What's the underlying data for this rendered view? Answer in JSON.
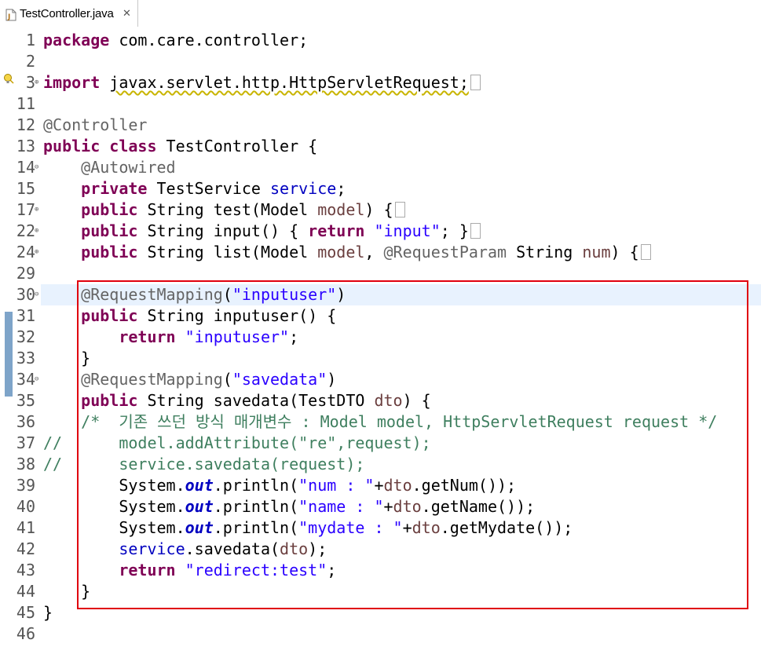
{
  "tab": {
    "title": "TestController.java",
    "close": "✕"
  },
  "lines": [
    {
      "num": "1",
      "fold": "",
      "html": "<span class='kw'>package</span> com.care.controller;"
    },
    {
      "num": "2",
      "fold": "",
      "html": ""
    },
    {
      "num": "3",
      "fold": "⊕",
      "html": "<span class='kw'>import</span> <span class='squig'>javax.servlet.http.HttpServletRequest;</span><span class='collapsed'></span>"
    },
    {
      "num": "11",
      "fold": "",
      "html": ""
    },
    {
      "num": "12",
      "fold": "",
      "html": "<span class='ann'>@Controller</span>"
    },
    {
      "num": "13",
      "fold": "",
      "html": "<span class='kw'>public</span> <span class='kw'>class</span> TestController {"
    },
    {
      "num": "14",
      "fold": "⊖",
      "html": "    <span class='ann'>@Autowired</span>"
    },
    {
      "num": "15",
      "fold": "",
      "html": "    <span class='kw'>private</span> TestService <span class='field'>service</span>;"
    },
    {
      "num": "17",
      "fold": "⊕",
      "html": "    <span class='kw'>public</span> String test(Model <span class='param'>model</span>) {<span class='collapsed'></span>"
    },
    {
      "num": "22",
      "fold": "⊕",
      "html": "    <span class='kw'>public</span> String input() { <span class='kw'>return</span> <span class='str'>\"input\"</span>; }<span class='collapsed'></span>"
    },
    {
      "num": "24",
      "fold": "⊕",
      "html": "    <span class='kw'>public</span> String list(Model <span class='param'>model</span>, <span class='ann'>@RequestParam</span> String <span class='param'>num</span>) {<span class='collapsed'></span>"
    },
    {
      "num": "29",
      "fold": "",
      "html": ""
    },
    {
      "num": "30",
      "fold": "⊖",
      "html": "    <span class='ann'>@RequestMapping</span>(<span class='str'>\"inputuser\"</span>)",
      "current": true
    },
    {
      "num": "31",
      "fold": "",
      "html": "    <span class='kw'>public</span> String inputuser() {"
    },
    {
      "num": "32",
      "fold": "",
      "html": "        <span class='kw'>return</span> <span class='str'>\"inputuser\"</span>;"
    },
    {
      "num": "33",
      "fold": "",
      "html": "    }"
    },
    {
      "num": "34",
      "fold": "⊖",
      "html": "    <span class='ann'>@RequestMapping</span>(<span class='str'>\"savedata\"</span>)"
    },
    {
      "num": "35",
      "fold": "",
      "html": "    <span class='kw'>public</span> String savedata(TestDTO <span class='param'>dto</span>) {"
    },
    {
      "num": "36",
      "fold": "",
      "html": "    <span class='cmt'>/*  기존 쓰던 방식 매개변수 : Model model, HttpServletRequest request */</span>"
    },
    {
      "num": "37",
      "fold": "",
      "html": "<span class='cmt'>//      model.addAttribute(\"re\",request);</span>"
    },
    {
      "num": "38",
      "fold": "",
      "html": "<span class='cmt'>//      service.savedata(request);</span>"
    },
    {
      "num": "39",
      "fold": "",
      "html": "        System.<span class='static'>out</span>.println(<span class='str'>\"num : \"</span>+<span class='param'>dto</span>.getNum());"
    },
    {
      "num": "40",
      "fold": "",
      "html": "        System.<span class='static'>out</span>.println(<span class='str'>\"name : \"</span>+<span class='param'>dto</span>.getName());"
    },
    {
      "num": "41",
      "fold": "",
      "html": "        System.<span class='static'>out</span>.println(<span class='str'>\"mydate : \"</span>+<span class='param'>dto</span>.getMydate());"
    },
    {
      "num": "42",
      "fold": "",
      "html": "        <span class='field'>service</span>.savedata(<span class='param'>dto</span>);"
    },
    {
      "num": "43",
      "fold": "",
      "html": "        <span class='kw'>return</span> <span class='str'>\"redirect:test\"</span>;"
    },
    {
      "num": "44",
      "fold": "",
      "html": "    }"
    },
    {
      "num": "45",
      "fold": "",
      "html": "}"
    },
    {
      "num": "46",
      "fold": "",
      "html": ""
    }
  ],
  "colors": {
    "highlight_box": "#e0000e",
    "keyword": "#7f0055",
    "string": "#2a00ff",
    "comment": "#3f7f5f"
  }
}
